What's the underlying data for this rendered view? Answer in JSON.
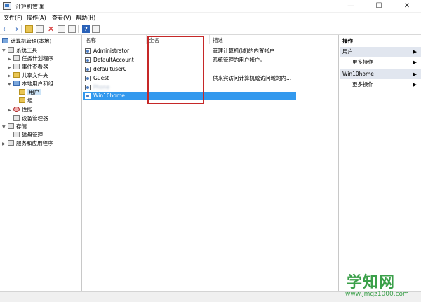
{
  "window": {
    "title": "计算机管理",
    "controls": {
      "minimize": "—",
      "maximize": "☐",
      "close": "✕"
    }
  },
  "menu": [
    "文件(F)",
    "操作(A)",
    "查看(V)",
    "帮助(H)"
  ],
  "toolbar": {
    "back": "←",
    "forward": "→",
    "delete": "✕",
    "help": "?"
  },
  "tree": [
    {
      "label": "计算机管理(本地)"
    },
    {
      "label": "系统工具"
    },
    {
      "label": "任务计划程序"
    },
    {
      "label": "事件查看器"
    },
    {
      "label": "共享文件夹"
    },
    {
      "label": "本地用户和组"
    },
    {
      "label": "用户"
    },
    {
      "label": "组"
    },
    {
      "label": "性能"
    },
    {
      "label": "设备管理器"
    },
    {
      "label": "存储"
    },
    {
      "label": "磁盘管理"
    },
    {
      "label": "服务和应用程序"
    }
  ],
  "list": {
    "columns": [
      "名称",
      "全名",
      "描述"
    ],
    "rows": [
      {
        "name": "Administrator",
        "description": "管理计算机(域)的内置帐户"
      },
      {
        "name": "DefaultAccount",
        "description": "系统管理的用户帐户。"
      },
      {
        "name": "defaultuser0",
        "description": ""
      },
      {
        "name": "Guest",
        "description": "供来宾访问计算机或访问域的内..."
      },
      {
        "name": "Phone",
        "description": ""
      },
      {
        "name": "Win10home",
        "description": ""
      }
    ]
  },
  "actions": {
    "title": "操作",
    "sections": [
      {
        "label": "用户",
        "item": "更多操作"
      },
      {
        "label": "Win10home",
        "item": "更多操作"
      }
    ],
    "arrow": "▶"
  },
  "watermark": {
    "main": "学知网",
    "url": "www.jmqz1000.com"
  },
  "colors": {
    "selection": "#3399ee",
    "highlight": "#c62828",
    "section_bg": "#e1e6ef",
    "watermark": "#3ba04a"
  }
}
